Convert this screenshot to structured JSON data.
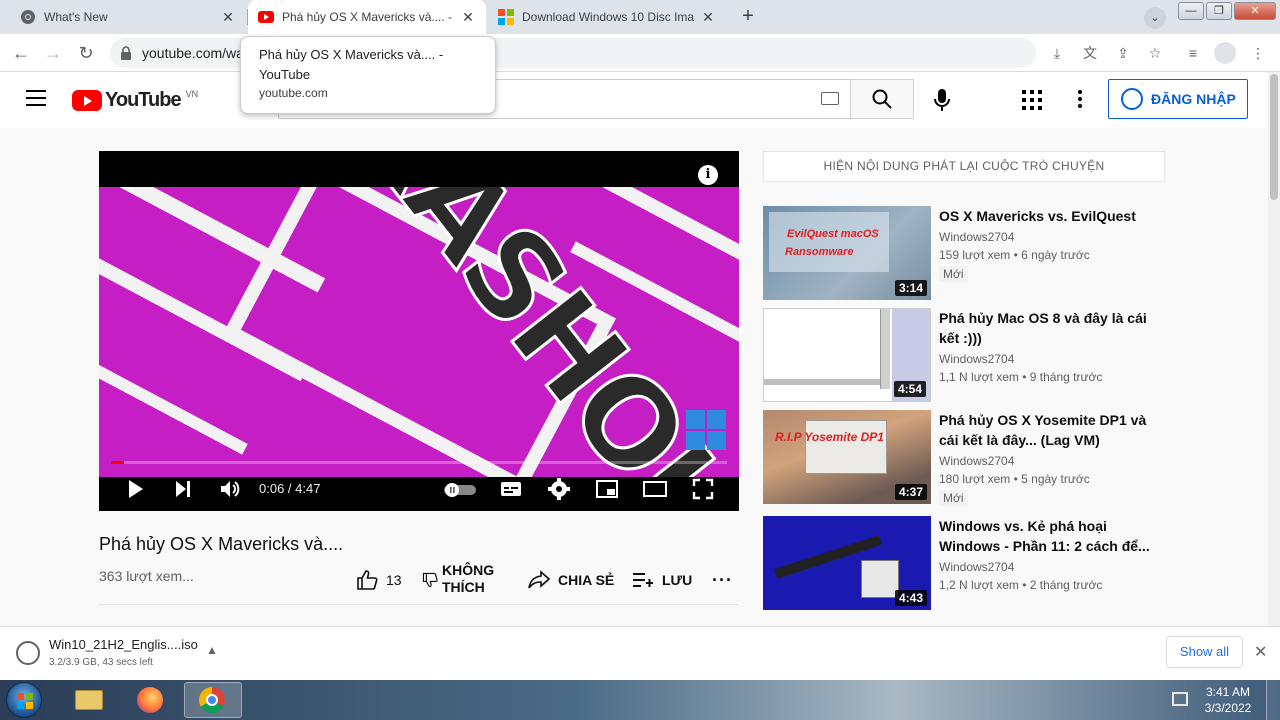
{
  "browser": {
    "tabs": [
      {
        "title": "What's New",
        "active": false
      },
      {
        "title": "Phá hủy OS X Mavericks và.... - YouTube",
        "active": true
      },
      {
        "title": "Download Windows 10 Disc Image",
        "active": false
      }
    ],
    "new_tab_label": "+",
    "url": "youtube.com/wa",
    "tooltip": {
      "title": "Phá hủy OS X Mavericks và.... - YouTube",
      "domain": "youtube.com"
    }
  },
  "youtube": {
    "logo_text": "YouTube",
    "country_code": "VN",
    "sign_in_label": "ĐĂNG NHẬP"
  },
  "player": {
    "time_current": "0:06",
    "time_total": "4:47",
    "time_display": "0:06 / 4:47",
    "progress_fraction": 0.021,
    "frame_text": "CRASHOUT"
  },
  "video": {
    "title": "Phá hủy OS X Mavericks và....",
    "views": "363 lượt xem...",
    "likes": "13",
    "dislike_label_line1": "KHÔNG",
    "dislike_label_line2": "THÍCH",
    "share_label": "CHIA SẺ",
    "save_label": "LƯU"
  },
  "sidebar": {
    "chat_replay_label": "HIỆN NỘI DUNG PHÁT LẠI CUỘC TRÒ CHUYỆN",
    "recommendations": [
      {
        "title": "OS X Mavericks vs. EvilQuest",
        "channel": "Windows2704",
        "stats": "159 lượt xem • 6 ngày trước",
        "badge": "Mới",
        "duration": "3:14",
        "thumb_text_1": "EvilQuest macOS",
        "thumb_text_2": "Ransomware"
      },
      {
        "title": "Phá hủy Mac OS 8 và đây là cái kết :)))",
        "channel": "Windows2704",
        "stats": "1,1 N lượt xem • 9 tháng trước",
        "badge": "",
        "duration": "4:54"
      },
      {
        "title": "Phá hủy OS X Yosemite DP1 và cái kết là đây... (Lag VM)",
        "channel": "Windows2704",
        "stats": "180 lượt xem • 5 ngày trước",
        "badge": "Mới",
        "duration": "4:37",
        "thumb_text_1": "R.I.P Yosemite DP1"
      },
      {
        "title": "Windows vs. Kẻ phá hoại Windows - Phần 11: 2 cách để...",
        "channel": "Windows2704",
        "stats": "1,2 N lượt xem • 2 tháng trước",
        "badge": "",
        "duration": "4:43"
      }
    ]
  },
  "download": {
    "filename": "Win10_21H2_Englis....iso",
    "status": "3.2/3.9 GB, 43 secs left",
    "show_all_label": "Show all"
  },
  "taskbar": {
    "time": "3:41 AM",
    "date": "3/3/2022"
  },
  "colors": {
    "youtube_red": "#ff0000",
    "link_blue": "#065fd4",
    "chrome_blue": "#1a73e8",
    "player_magenta": "#c41ec4"
  }
}
